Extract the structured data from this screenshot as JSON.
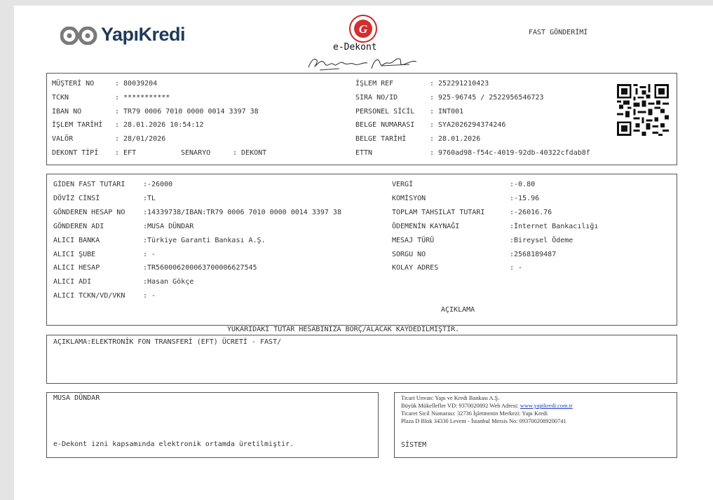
{
  "brand": {
    "name": "YapıKredi",
    "logo_icon": "yapikredi-swirl-logo",
    "seal_icon": "red-circle-seal"
  },
  "header": {
    "title": "FAST GÖNDERİMİ",
    "doc_name": "e-Dekont",
    "signature": "signature"
  },
  "top_info": {
    "left": [
      {
        "label": "MÜŞTERİ NO",
        "value": ": 80039204"
      },
      {
        "label": "TCKN",
        "value": ": ***********"
      },
      {
        "label": "IBAN NO",
        "value": ": TR79 0006 7010 0000 0014 3397 38"
      },
      {
        "label": "İŞLEM TARİHİ",
        "value": ": 28.01.2026 10:54:12"
      },
      {
        "label": "VALÖR",
        "value": ": 28/01/2026"
      },
      {
        "label": "DEKONT TİPİ",
        "value": ": EFT"
      }
    ],
    "senaryo_label": "SENARYO",
    "senaryo_value": ": DEKONT",
    "right": [
      {
        "label": "İŞLEM REF",
        "value": ": 252291210423"
      },
      {
        "label": "SIRA NO/ID",
        "value": ": 925-96745 / 2522956546723"
      },
      {
        "label": "PERSONEL SİCİL",
        "value": ": INT001"
      },
      {
        "label": "BELGE NUMARASI",
        "value": ": SYA2026294374246"
      },
      {
        "label": "BELGE TARİHİ",
        "value": ": 28.01.2026"
      },
      {
        "label": "ETTN",
        "value": ": 9760ad98-f54c-4019-92db-40322cfdab8f"
      }
    ],
    "qr_icon": "qr-code"
  },
  "transfer": {
    "left": [
      {
        "label": "GİDEN FAST TUTARI",
        "value": ":-26000"
      },
      {
        "label": "DÖVİZ CİNSİ",
        "value": ":TL"
      },
      {
        "label": "GÖNDEREN HESAP NO",
        "value": ":14339738/IBAN:TR79 0006 7010 0000 0014 3397 38"
      },
      {
        "label": "GÖNDEREN ADI",
        "value": ":MUSA DÜNDAR"
      },
      {
        "label": "ALICI BANKA",
        "value": ":Türkiye Garanti Bankası A.Ş."
      },
      {
        "label": "ALICI ŞUBE",
        "value": ": -"
      },
      {
        "label": "ALICI HESAP",
        "value": ":TR560006200063700006627545"
      },
      {
        "label": "ALICI ADI",
        "value": ":Hasan Gökçe"
      },
      {
        "label": "ALICI TCKN/VD/VKN",
        "value": ": -"
      }
    ],
    "right": [
      {
        "label": "VERGİ",
        "value": ":-0.80"
      },
      {
        "label": "KOMİSYON",
        "value": ":-15.96"
      },
      {
        "label": "TOPLAM TAHSILAT TUTARI",
        "value": ":-26016.76"
      },
      {
        "label": "ÖDEMENİN KAYNAĞI",
        "value": ":İnternet Bankacılığı"
      },
      {
        "label": "MESAJ TÜRÜ",
        "value": ":Bireysel Ödeme"
      },
      {
        "label": "SORGU NO",
        "value": ":2568189487"
      },
      {
        "label": "KOLAY ADRES",
        "value": ": -"
      }
    ],
    "aciklama_heading": "AÇIKLAMA"
  },
  "notice": "YUKARIDAKİ TUTAR HESABINIZA BORÇ/ALACAK KAYDEDİLMİŞTİR.",
  "description": "AÇIKLAMA:ELEKTRONİK FON TRANSFERİ (EFT) ÜCRETİ - FAST/",
  "footer_left": {
    "name": "MUSA DÜNDAR",
    "note": "e-Dekont izni kapsamında elektronik ortamda üretilmiştir."
  },
  "footer_right": {
    "line1": "Ticari Unvan: Yapı ve Kredi Bankası A.Ş.",
    "line2_prefix": "Büyük Mükellefler VD: 9370020892 Web Adresi: ",
    "line2_link": "www.yapikredi.com.tr",
    "line3": "Ticaret Sicil Numarası: 32736 İşletmenin Merkezi: Yapı Kredi",
    "line4": "Plaza D Blok 34330 Levent - İstanbul Mersis No: 0937002089200741",
    "system": "SİSTEM"
  }
}
